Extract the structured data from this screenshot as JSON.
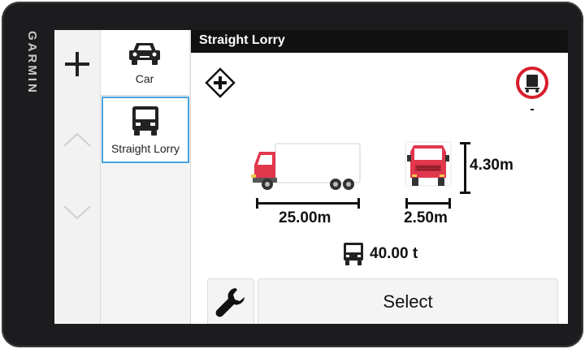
{
  "device": {
    "brand": "GARMIN"
  },
  "header": {
    "title": "Straight Lorry"
  },
  "nav": {
    "add_icon": "plus-icon",
    "up_icon": "chevron-up-icon",
    "down_icon": "chevron-down-icon"
  },
  "profiles": [
    {
      "label": "Car",
      "icon": "car-icon",
      "selected": false
    },
    {
      "label": "Straight Lorry",
      "icon": "lorry-icon",
      "selected": true
    }
  ],
  "restriction": {
    "icon": "no-trailer-sign-icon",
    "value": "-"
  },
  "dimensions": {
    "length": "25.00m",
    "width": "2.50m",
    "height": "4.30m"
  },
  "weight": {
    "value": "40.00 t"
  },
  "actions": {
    "tools_icon": "wrench-icon",
    "select_label": "Select"
  },
  "colors": {
    "accent": "#4aa3df",
    "truck_cab": "#e0374d",
    "sign_red": "#d81e2c"
  }
}
